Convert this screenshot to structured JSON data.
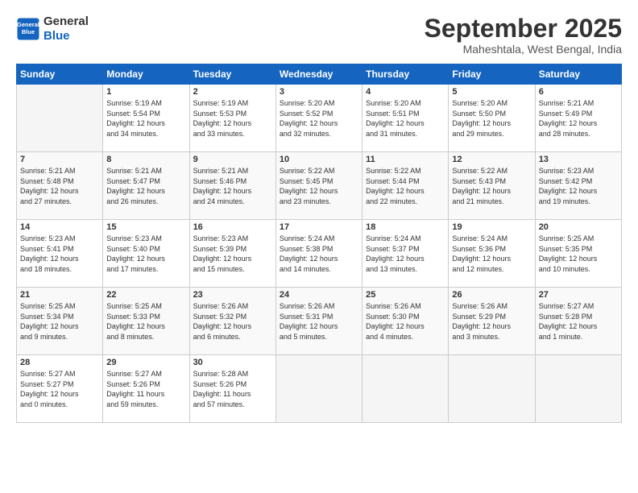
{
  "header": {
    "logo_line1": "General",
    "logo_line2": "Blue",
    "title": "September 2025",
    "location": "Maheshtala, West Bengal, India"
  },
  "days_of_week": [
    "Sunday",
    "Monday",
    "Tuesday",
    "Wednesday",
    "Thursday",
    "Friday",
    "Saturday"
  ],
  "weeks": [
    [
      {
        "day": "",
        "text": ""
      },
      {
        "day": "1",
        "text": "Sunrise: 5:19 AM\nSunset: 5:54 PM\nDaylight: 12 hours\nand 34 minutes."
      },
      {
        "day": "2",
        "text": "Sunrise: 5:19 AM\nSunset: 5:53 PM\nDaylight: 12 hours\nand 33 minutes."
      },
      {
        "day": "3",
        "text": "Sunrise: 5:20 AM\nSunset: 5:52 PM\nDaylight: 12 hours\nand 32 minutes."
      },
      {
        "day": "4",
        "text": "Sunrise: 5:20 AM\nSunset: 5:51 PM\nDaylight: 12 hours\nand 31 minutes."
      },
      {
        "day": "5",
        "text": "Sunrise: 5:20 AM\nSunset: 5:50 PM\nDaylight: 12 hours\nand 29 minutes."
      },
      {
        "day": "6",
        "text": "Sunrise: 5:21 AM\nSunset: 5:49 PM\nDaylight: 12 hours\nand 28 minutes."
      }
    ],
    [
      {
        "day": "7",
        "text": "Sunrise: 5:21 AM\nSunset: 5:48 PM\nDaylight: 12 hours\nand 27 minutes."
      },
      {
        "day": "8",
        "text": "Sunrise: 5:21 AM\nSunset: 5:47 PM\nDaylight: 12 hours\nand 26 minutes."
      },
      {
        "day": "9",
        "text": "Sunrise: 5:21 AM\nSunset: 5:46 PM\nDaylight: 12 hours\nand 24 minutes."
      },
      {
        "day": "10",
        "text": "Sunrise: 5:22 AM\nSunset: 5:45 PM\nDaylight: 12 hours\nand 23 minutes."
      },
      {
        "day": "11",
        "text": "Sunrise: 5:22 AM\nSunset: 5:44 PM\nDaylight: 12 hours\nand 22 minutes."
      },
      {
        "day": "12",
        "text": "Sunrise: 5:22 AM\nSunset: 5:43 PM\nDaylight: 12 hours\nand 21 minutes."
      },
      {
        "day": "13",
        "text": "Sunrise: 5:23 AM\nSunset: 5:42 PM\nDaylight: 12 hours\nand 19 minutes."
      }
    ],
    [
      {
        "day": "14",
        "text": "Sunrise: 5:23 AM\nSunset: 5:41 PM\nDaylight: 12 hours\nand 18 minutes."
      },
      {
        "day": "15",
        "text": "Sunrise: 5:23 AM\nSunset: 5:40 PM\nDaylight: 12 hours\nand 17 minutes."
      },
      {
        "day": "16",
        "text": "Sunrise: 5:23 AM\nSunset: 5:39 PM\nDaylight: 12 hours\nand 15 minutes."
      },
      {
        "day": "17",
        "text": "Sunrise: 5:24 AM\nSunset: 5:38 PM\nDaylight: 12 hours\nand 14 minutes."
      },
      {
        "day": "18",
        "text": "Sunrise: 5:24 AM\nSunset: 5:37 PM\nDaylight: 12 hours\nand 13 minutes."
      },
      {
        "day": "19",
        "text": "Sunrise: 5:24 AM\nSunset: 5:36 PM\nDaylight: 12 hours\nand 12 minutes."
      },
      {
        "day": "20",
        "text": "Sunrise: 5:25 AM\nSunset: 5:35 PM\nDaylight: 12 hours\nand 10 minutes."
      }
    ],
    [
      {
        "day": "21",
        "text": "Sunrise: 5:25 AM\nSunset: 5:34 PM\nDaylight: 12 hours\nand 9 minutes."
      },
      {
        "day": "22",
        "text": "Sunrise: 5:25 AM\nSunset: 5:33 PM\nDaylight: 12 hours\nand 8 minutes."
      },
      {
        "day": "23",
        "text": "Sunrise: 5:26 AM\nSunset: 5:32 PM\nDaylight: 12 hours\nand 6 minutes."
      },
      {
        "day": "24",
        "text": "Sunrise: 5:26 AM\nSunset: 5:31 PM\nDaylight: 12 hours\nand 5 minutes."
      },
      {
        "day": "25",
        "text": "Sunrise: 5:26 AM\nSunset: 5:30 PM\nDaylight: 12 hours\nand 4 minutes."
      },
      {
        "day": "26",
        "text": "Sunrise: 5:26 AM\nSunset: 5:29 PM\nDaylight: 12 hours\nand 3 minutes."
      },
      {
        "day": "27",
        "text": "Sunrise: 5:27 AM\nSunset: 5:28 PM\nDaylight: 12 hours\nand 1 minute."
      }
    ],
    [
      {
        "day": "28",
        "text": "Sunrise: 5:27 AM\nSunset: 5:27 PM\nDaylight: 12 hours\nand 0 minutes."
      },
      {
        "day": "29",
        "text": "Sunrise: 5:27 AM\nSunset: 5:26 PM\nDaylight: 11 hours\nand 59 minutes."
      },
      {
        "day": "30",
        "text": "Sunrise: 5:28 AM\nSunset: 5:26 PM\nDaylight: 11 hours\nand 57 minutes."
      },
      {
        "day": "",
        "text": ""
      },
      {
        "day": "",
        "text": ""
      },
      {
        "day": "",
        "text": ""
      },
      {
        "day": "",
        "text": ""
      }
    ]
  ]
}
